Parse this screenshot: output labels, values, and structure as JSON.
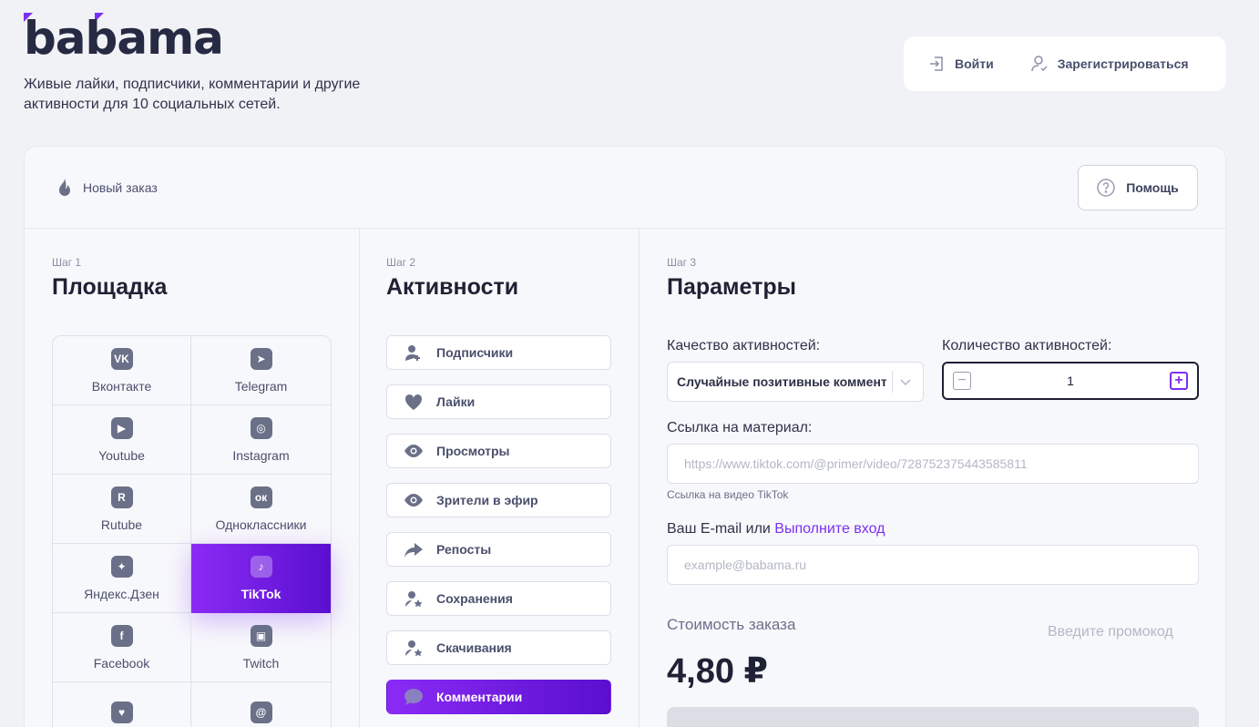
{
  "brand": {
    "logo_text": "babama",
    "accent_color": "#7b2ff2"
  },
  "tagline": "Живые лайки, подписчики, комментарии и другие активности для 10 социальных сетей.",
  "auth": {
    "login_label": "Войти",
    "register_label": "Зарегистрироваться"
  },
  "header": {
    "new_order_label": "Новый заказ",
    "help_label": "Помощь"
  },
  "step1": {
    "step_label": "Шаг 1",
    "title": "Площадка",
    "platforms": [
      {
        "label": "Вконтакте",
        "icon": "vk-icon"
      },
      {
        "label": "Telegram",
        "icon": "telegram-icon"
      },
      {
        "label": "Youtube",
        "icon": "youtube-icon"
      },
      {
        "label": "Instagram",
        "icon": "instagram-icon"
      },
      {
        "label": "Rutube",
        "icon": "rutube-icon"
      },
      {
        "label": "Одноклассники",
        "icon": "odnoklassniki-icon"
      },
      {
        "label": "Яндекс.Дзен",
        "icon": "zen-icon"
      },
      {
        "label": "TikTok",
        "icon": "tiktok-icon",
        "active": true
      },
      {
        "label": "Facebook",
        "icon": "facebook-icon"
      },
      {
        "label": "Twitch",
        "icon": "twitch-icon"
      },
      {
        "label": "",
        "icon": "likee-icon"
      },
      {
        "label": "",
        "icon": "threads-icon"
      }
    ]
  },
  "step2": {
    "step_label": "Шаг 2",
    "title": "Активности",
    "activities": [
      {
        "label": "Подписчики",
        "icon": "add-user-icon"
      },
      {
        "label": "Лайки",
        "icon": "heart-icon"
      },
      {
        "label": "Просмотры",
        "icon": "eye-icon"
      },
      {
        "label": "Зрители в эфир",
        "icon": "eye-icon"
      },
      {
        "label": "Репосты",
        "icon": "share-icon"
      },
      {
        "label": "Сохранения",
        "icon": "user-star-icon"
      },
      {
        "label": "Скачивания",
        "icon": "user-star-icon"
      },
      {
        "label": "Комментарии",
        "icon": "comment-icon",
        "active": true
      }
    ]
  },
  "step3": {
    "step_label": "Шаг 3",
    "title": "Параметры",
    "quality_label": "Качество активностей:",
    "quality_value": "Случайные позитивные комментарии",
    "quantity_label": "Количество активностей:",
    "quantity_value": "1",
    "link_label": "Ссылка на материал:",
    "link_placeholder": "https://www.tiktok.com/@primer/video/7287523754435858​11",
    "link_hint": "Ссылка на видео TikTok",
    "email_label_prefix": "Ваш E-mail или",
    "email_label_link": "Выполните вход",
    "email_placeholder": "example@babama.ru",
    "cost_label": "Стоимость заказа",
    "promo_label": "Введите промокод",
    "price": "4,80 ₽"
  }
}
